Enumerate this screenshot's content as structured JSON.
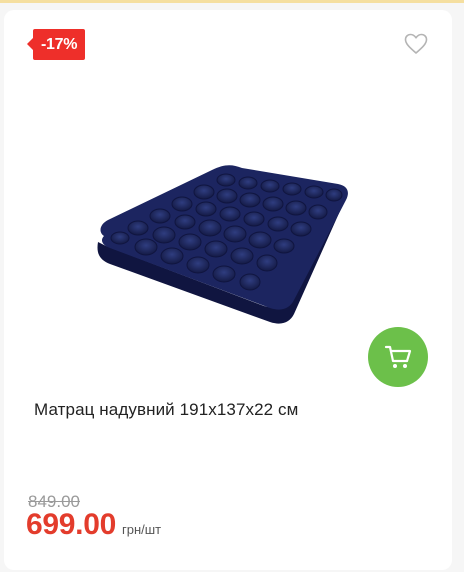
{
  "product": {
    "discount_badge": "-17%",
    "title": "Матрац надувний 191x137x22 см",
    "old_price": "849.00",
    "price": "699.00",
    "unit": "грн/шт"
  },
  "icons": {
    "wishlist": "heart-outline-icon",
    "cart": "shopping-cart-icon"
  },
  "colors": {
    "badge": "#ee2f2a",
    "price": "#e33c2c",
    "cart_button": "#6cc04a",
    "product": "#1b2455"
  }
}
